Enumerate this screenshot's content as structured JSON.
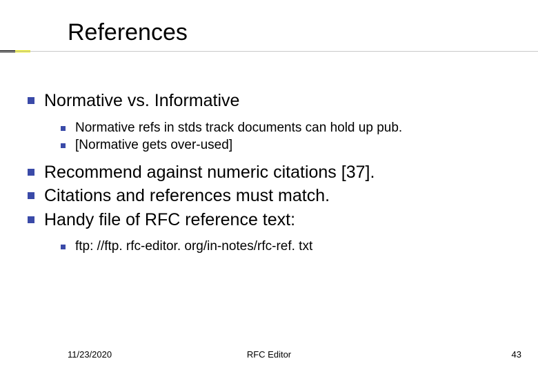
{
  "title": "References",
  "bullets": {
    "b1": "Normative vs. Informative",
    "b1a": "Normative refs in stds track documents can hold up pub.",
    "b1b": "[Normative gets over-used]",
    "b2": "Recommend against numeric citations [37].",
    "b3": "Citations and references must match.",
    "b4": "Handy file of RFC reference text:",
    "b4a": "ftp: //ftp. rfc-editor. org/in-notes/rfc-ref. txt"
  },
  "footer": {
    "date": "11/23/2020",
    "center": "RFC Editor",
    "page": "43"
  }
}
